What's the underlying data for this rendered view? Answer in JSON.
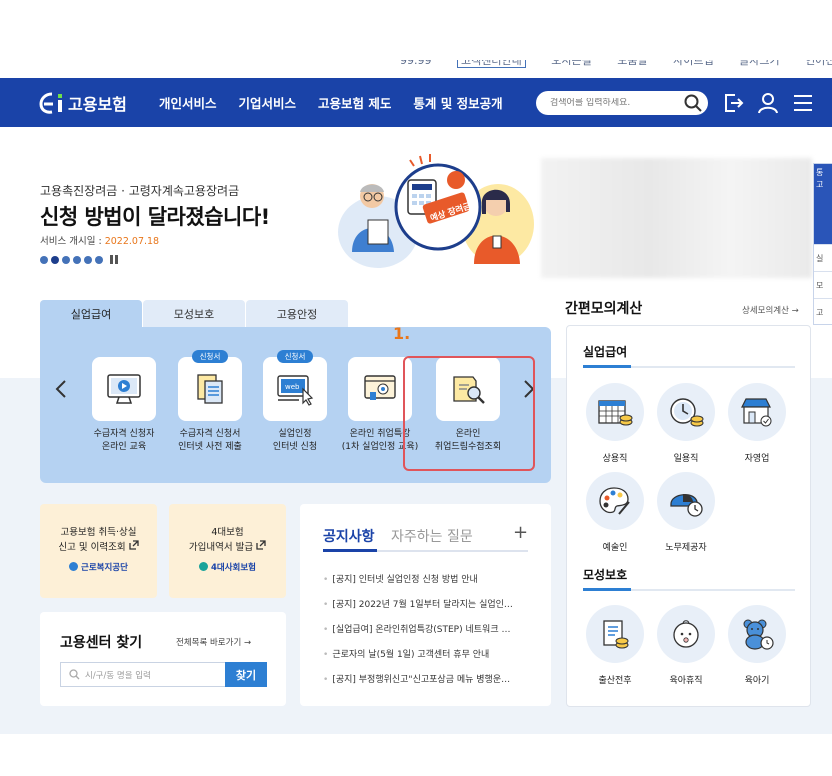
{
  "utility": {
    "items": [
      "99.99",
      "고객센터안내",
      "오시는길",
      "도움말",
      "사이트맵",
      "글자크기",
      "언어선택"
    ]
  },
  "header": {
    "logo": "고용보험",
    "nav": [
      "개인서비스",
      "기업서비스",
      "고용보험 제도",
      "통계 및 정보공개"
    ],
    "search_placeholder": "검색어를 입력하세요."
  },
  "hero": {
    "subtitle": "고용촉진장려금 · 고령자계속고용장려금",
    "title": "신청 방법이 달라졌습니다!",
    "date_label": "서비스 개시일 : ",
    "date_value": "2022.07.18",
    "illustration_text": "예상 장려금"
  },
  "side_tab": {
    "top": "통 고",
    "rows": [
      "실",
      "모",
      "고"
    ]
  },
  "tabs": [
    {
      "label": "실업급여",
      "active": true
    },
    {
      "label": "모성보호",
      "active": false
    },
    {
      "label": "고용안정",
      "active": false
    }
  ],
  "services": [
    {
      "line1": "수급자격 신청자",
      "line2": "온라인 교육",
      "badge": "",
      "icon": "monitor-video-icon"
    },
    {
      "line1": "수급자격 신청서",
      "line2": "인터넷 사전 제출",
      "badge": "신청서",
      "icon": "document-form-icon"
    },
    {
      "line1": "실업인정",
      "line2": "인터넷 신청",
      "badge": "신청서",
      "icon": "web-apply-icon"
    },
    {
      "line1": "온라인 취업특강",
      "line2": "(1차 실업인정 교육)",
      "badge": "",
      "icon": "online-lecture-icon"
    },
    {
      "line1": "온라인",
      "line2": "취업드림수첩조회",
      "badge": "",
      "icon": "notebook-search-icon"
    }
  ],
  "annotation": "1.",
  "cards": [
    {
      "line1": "고용보험 취득·상실",
      "line2": "신고 및 이력조회",
      "org": "근로복지공단"
    },
    {
      "line1": "4대보험",
      "line2": "가입내역서 발급",
      "org": "4대사회보험"
    }
  ],
  "center": {
    "title": "고용센터 찾기",
    "link": "전체목록 바로가기",
    "placeholder": "시/구/동 명을 입력",
    "button": "찾기"
  },
  "notices": {
    "tab_active": "공지사항",
    "tab_inactive": "자주하는 질문",
    "more": "+",
    "items": [
      "[공지] 인터넷 실업인정 신청 방법 안내",
      "[공지] 2022년 7월 1일부터 달라지는 실업인…",
      "[실업급여] 온라인취업특강(STEP) 네트워크 …",
      "근로자의 날(5월 1일) 고객센터 휴무 안내",
      "[공지] 부정행위신고\"신고포상금 메뉴 병행운…"
    ]
  },
  "calculator": {
    "title": "간편모의계산",
    "link": "상세모의계산",
    "section1": "실업급여",
    "section1_items": [
      "상용직",
      "일용직",
      "자영업",
      "예술인",
      "노무제공자"
    ],
    "section2": "모성보호",
    "section2_items": [
      "출산전후",
      "육아휴직",
      "육아기"
    ]
  },
  "colors": {
    "header": "#1a43a8",
    "accent": "#2d7fd3",
    "tab_panel": "#b5d2f2",
    "highlight": "#e0555a",
    "date": "#e8761b"
  }
}
